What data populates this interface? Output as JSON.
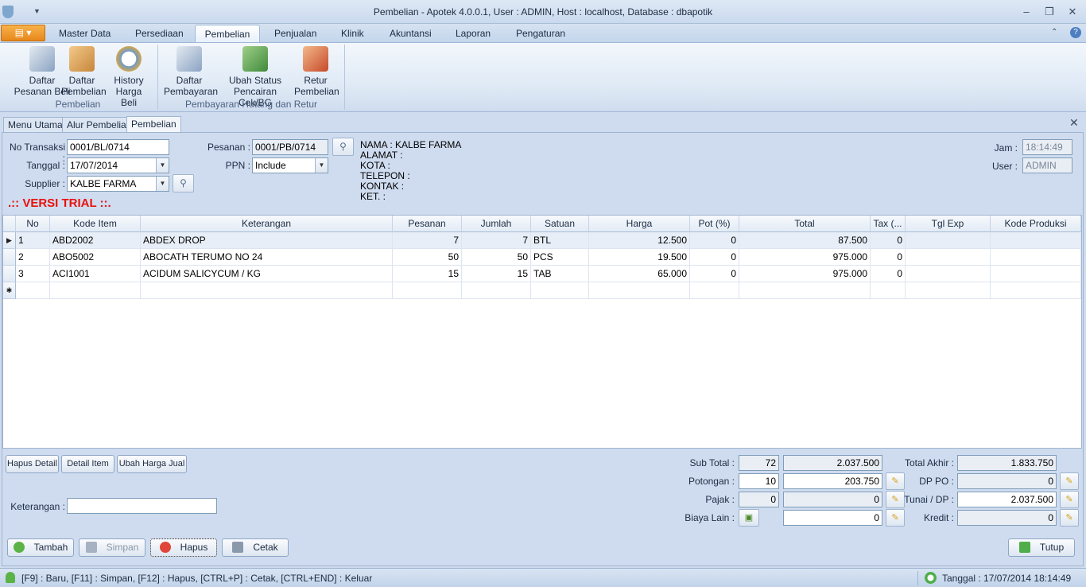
{
  "window": {
    "title": "Pembelian - Apotek 4.0.0.1,  User : ADMIN, Host : localhost, Database : dbapotik",
    "minimize": "–",
    "restore": "❐",
    "close": "✕"
  },
  "ribbon_tabs": [
    "Master Data",
    "Persediaan",
    "Pembelian",
    "Penjualan",
    "Klinik",
    "Akuntansi",
    "Laporan",
    "Pengaturan"
  ],
  "ribbon": {
    "group1_label": "Pembelian",
    "group2_label": "Pembayaran Hutang dan Retur",
    "buttons": [
      {
        "line1": "Daftar",
        "line2": "Pesanan Beli"
      },
      {
        "line1": "Daftar",
        "line2": "Pembelian"
      },
      {
        "line1": "History",
        "line2": "Harga Beli"
      },
      {
        "line1": "Daftar",
        "line2": "Pembayaran"
      },
      {
        "line1": "Ubah Status",
        "line2": "Pencairan Cek/BG"
      },
      {
        "line1": "Retur",
        "line2": "Pembelian"
      }
    ]
  },
  "doc_tabs": [
    "Menu Utama",
    "Alur Pembelian",
    "Pembelian"
  ],
  "form": {
    "no_transaksi_label": "No Transaksi :",
    "no_transaksi": "0001/BL/0714",
    "tanggal_label": "Tanggal :",
    "tanggal": "17/07/2014",
    "supplier_label": "Supplier :",
    "supplier": "KALBE FARMA",
    "pesanan_label": "Pesanan :",
    "pesanan": "0001/PB/0714",
    "ppn_label": "PPN :",
    "ppn": "Include",
    "trial": ".:: VERSI TRIAL ::.",
    "nama": "NAMA : KALBE FARMA",
    "alamat": "ALAMAT :",
    "kota": "KOTA :",
    "telepon": "TELEPON :",
    "kontak": "KONTAK :",
    "ket": "KET. :",
    "jam_label": "Jam :",
    "jam": "18:14:49",
    "user_label": "User :",
    "user": "ADMIN"
  },
  "grid": {
    "headers": [
      "No",
      "Kode Item",
      "Keterangan",
      "Pesanan",
      "Jumlah",
      "Satuan",
      "Harga",
      "Pot (%)",
      "Total",
      "Tax (...",
      "Tgl Exp",
      "Kode Produksi"
    ],
    "rows": [
      [
        "1",
        "ABD2002",
        "ABDEX DROP",
        "7",
        "7",
        "BTL",
        "12.500",
        "0",
        "87.500",
        "0",
        "",
        ""
      ],
      [
        "2",
        "ABO5002",
        "ABOCATH TERUMO NO 24",
        "50",
        "50",
        "PCS",
        "19.500",
        "0",
        "975.000",
        "0",
        "",
        ""
      ],
      [
        "3",
        "ACI1001",
        "ACIDUM SALICYCUM / KG",
        "15",
        "15",
        "TAB",
        "65.000",
        "0",
        "975.000",
        "0",
        "",
        ""
      ]
    ]
  },
  "detail_buttons": {
    "hapus_detail": "Hapus Detail",
    "detail_item": "Detail Item",
    "ubah_harga": "Ubah Harga Jual"
  },
  "keterangan_label": "Keterangan :",
  "summary": {
    "sub_total_label": "Sub Total :",
    "sub_total_qty": "72",
    "sub_total": "2.037.500",
    "potongan_label": "Potongan :",
    "potongan_pct": "10",
    "potongan": "203.750",
    "pajak_label": "Pajak :",
    "pajak_pct": "0",
    "pajak": "0",
    "biaya_label": "Biaya Lain :",
    "biaya": "0",
    "total_akhir_label": "Total Akhir :",
    "total_akhir": "1.833.750",
    "dp_po_label": "DP PO :",
    "dp_po": "0",
    "tunai_label": "Tunai / DP :",
    "tunai": "2.037.500",
    "kredit_label": "Kredit :",
    "kredit": "0"
  },
  "actions": {
    "tambah": "Tambah",
    "simpan": "Simpan",
    "hapus": "Hapus",
    "cetak": "Cetak",
    "tutup": "Tutup"
  },
  "status": {
    "shortcuts": "[F9] : Baru, [F11] : Simpan, [F12] : Hapus, [CTRL+P] : Cetak, [CTRL+END] : Keluar",
    "tanggal": "Tanggal : 17/07/2014 18:14:49"
  },
  "colors": {
    "trial": "#e8120c",
    "accent": "#f0a030"
  }
}
